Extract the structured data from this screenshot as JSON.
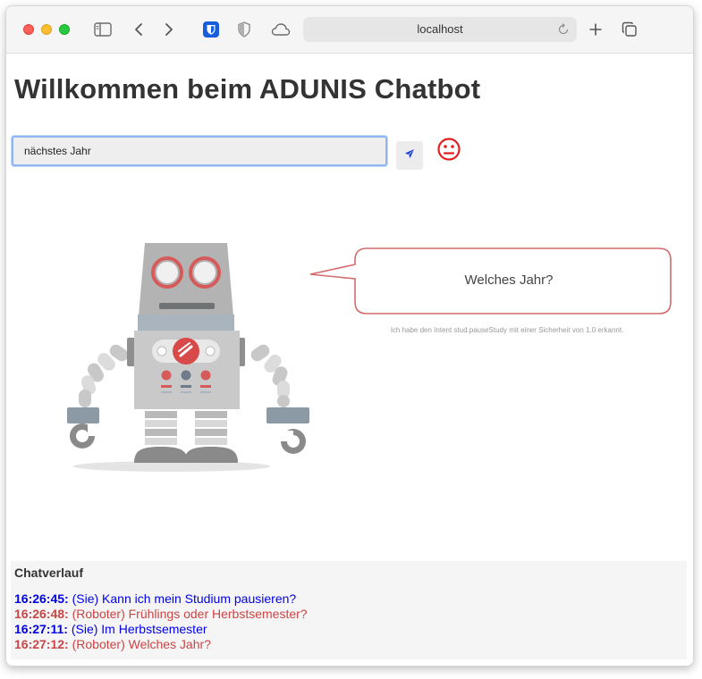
{
  "browser": {
    "address": "localhost"
  },
  "page": {
    "title": "Willkommen beim ADUNIS Chatbot",
    "input_value": "nächstes Jahr",
    "bubble_text": "Welches Jahr?",
    "intent_text": "Ich habe den Intent stud.pauseStudy mit einer Sicherheit von 1.0 erkannt."
  },
  "history": {
    "title": "Chatverlauf",
    "messages": [
      {
        "time": "16:26:45:",
        "text": "(Sie) Kann ich mein Studium pausieren?",
        "role": "user"
      },
      {
        "time": "16:26:48:",
        "text": "(Roboter) Frühlings oder Herbstsemester?",
        "role": "bot"
      },
      {
        "time": "16:27:11:",
        "text": "(Sie) Im Herbstsemester",
        "role": "user"
      },
      {
        "time": "16:27:12:",
        "text": "(Roboter) Welches Jahr?",
        "role": "bot"
      }
    ]
  },
  "colors": {
    "user": "#0000ee",
    "bot": "#cc4444",
    "emoji": "#e02020"
  },
  "icons": {
    "sidebar": "sidebar-icon",
    "back": "chevron-left-icon",
    "forward": "chevron-right-icon",
    "bitwarden": "shield-icon",
    "privacy": "half-shield-icon",
    "icloud": "cloud-icon",
    "reload": "reload-icon",
    "new_tab": "plus-icon",
    "tabs": "tab-overview-icon",
    "send": "paper-plane-icon",
    "mood": "neutral-face-icon"
  }
}
